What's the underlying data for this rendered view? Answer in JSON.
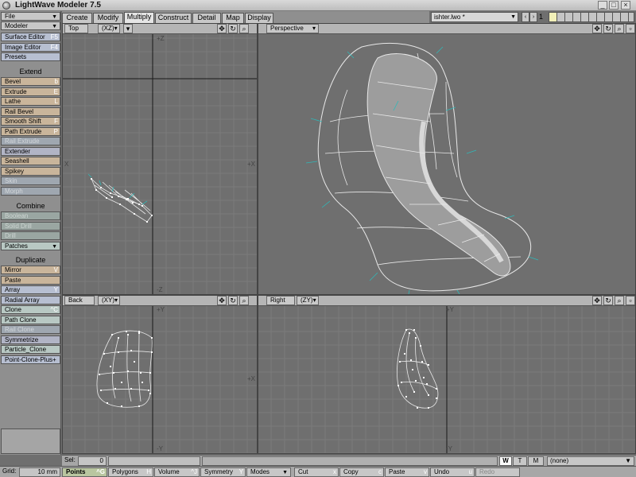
{
  "window": {
    "title": "LightWave Modeler 7.5",
    "minimize": "_",
    "maximize": "□",
    "close": "×"
  },
  "menus": {
    "file": "File",
    "modeler": "Modeler"
  },
  "left_toolbar": {
    "top_items": [
      {
        "label": "Surface Editor",
        "shortcut": "F5"
      },
      {
        "label": "Image Editor",
        "shortcut": "F4"
      },
      {
        "label": "Presets",
        "shortcut": ""
      }
    ],
    "extend_header": "Extend",
    "extend_items": [
      {
        "label": "Bevel",
        "shortcut": "b"
      },
      {
        "label": "Extrude",
        "shortcut": "E"
      },
      {
        "label": "Lathe",
        "shortcut": "L"
      },
      {
        "label": "Rail Bevel",
        "shortcut": ""
      },
      {
        "label": "Smooth Shift",
        "shortcut": "F"
      },
      {
        "label": "Path Extrude",
        "shortcut": "P"
      },
      {
        "label": "Rail Extrude",
        "shortcut": ""
      },
      {
        "label": "Extender",
        "shortcut": ""
      },
      {
        "label": "Seashell",
        "shortcut": ""
      },
      {
        "label": "Spikey",
        "shortcut": ""
      },
      {
        "label": "Skin",
        "shortcut": ""
      },
      {
        "label": "Morph",
        "shortcut": ""
      }
    ],
    "combine_header": "Combine",
    "combine_items": [
      {
        "label": "Boolean",
        "shortcut": ""
      },
      {
        "label": "Solid Drill",
        "shortcut": ""
      },
      {
        "label": "Drill",
        "shortcut": ""
      },
      {
        "label": "Patches",
        "shortcut": ""
      }
    ],
    "duplicate_header": "Duplicate",
    "duplicate_items": [
      {
        "label": "Mirror",
        "shortcut": "V"
      },
      {
        "label": "Paste",
        "shortcut": ""
      },
      {
        "label": "Array",
        "shortcut": "Y"
      },
      {
        "label": "Radial Array",
        "shortcut": ""
      },
      {
        "label": "Clone",
        "shortcut": "^C"
      },
      {
        "label": "Path Clone",
        "shortcut": ""
      },
      {
        "label": "Rail Clone",
        "shortcut": ""
      },
      {
        "label": "Symmetrize",
        "shortcut": ""
      },
      {
        "label": "Particle_Clone",
        "shortcut": ""
      },
      {
        "label": "Point-Clone-Plus+",
        "shortcut": ""
      }
    ]
  },
  "tabs": [
    "Create",
    "Modify",
    "Multiply",
    "Construct",
    "Detail",
    "Map",
    "Display"
  ],
  "active_tab": "Multiply",
  "object_file": "ishter.lwo *",
  "layer_number": "1",
  "viewports": {
    "top": {
      "label": "Top",
      "axes": "(XZ)"
    },
    "perspective": {
      "label": "Perspective"
    },
    "back": {
      "label": "Back",
      "axes": "(XY)"
    },
    "right": {
      "label": "Right",
      "axes": "(ZY)"
    }
  },
  "axis_labels": {
    "plus_z": "+Z",
    "minus_z": "-Z",
    "plus_x": "+X",
    "minus_x": "X",
    "plus_y": "+Y",
    "minus_y": "-Y"
  },
  "status": {
    "sel_label": "Sel:",
    "sel_count": "0",
    "wtm": [
      "W",
      "T",
      "M"
    ],
    "morph_value": "(none)",
    "grid_label": "Grid:",
    "grid_value": "10 mm"
  },
  "modes": [
    {
      "label": "Points",
      "shortcut": "^G"
    },
    {
      "label": "Polygons",
      "shortcut": "H"
    },
    {
      "label": "Volume",
      "shortcut": "^J"
    },
    {
      "label": "Symmetry",
      "shortcut": "Y"
    },
    {
      "label": "Modes",
      "shortcut": ""
    }
  ],
  "edit_buttons": [
    {
      "label": "Cut",
      "shortcut": "x"
    },
    {
      "label": "Copy",
      "shortcut": "c"
    },
    {
      "label": "Paste",
      "shortcut": "v"
    },
    {
      "label": "Undo",
      "shortcut": "u"
    },
    {
      "label": "Redo",
      "shortcut": ""
    }
  ],
  "icons": {
    "move": "move-view-icon",
    "rotate": "rotate-view-icon",
    "zoom": "zoom-view-icon",
    "maximize": "maximize-viewport-icon"
  },
  "colors": {
    "viewport_bg": "#6f6f6f",
    "grid_line": "#7b7b7b",
    "wireframe": "#e8e8e8",
    "normal_tick": "#2fb8b8",
    "active_layer": "#f2f0b8"
  }
}
